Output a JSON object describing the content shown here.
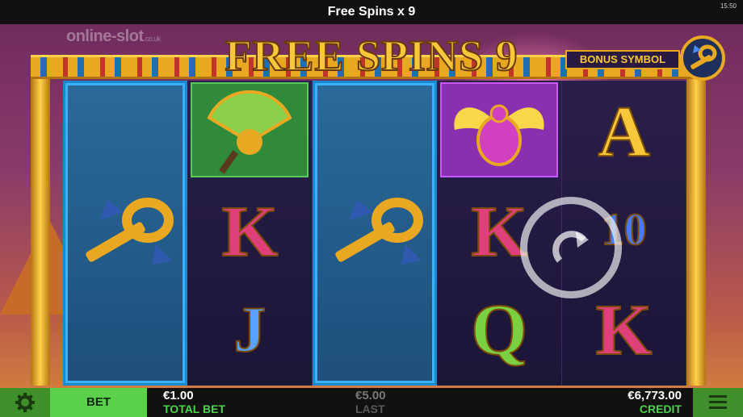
{
  "header": {
    "title": "Free Spins x 9",
    "clock": "15:50"
  },
  "watermark": {
    "text": "online-slot",
    "suffix": ".co.uk"
  },
  "game": {
    "banner": "FREE SPINS 9",
    "bonus_label": "BONUS SYMBOL",
    "bonus_symbol": "ankh-icon",
    "reels": [
      {
        "expanded": true,
        "symbol": "ankh-icon"
      },
      {
        "expanded": false,
        "symbols": [
          "fan-icon",
          "K",
          "J"
        ]
      },
      {
        "expanded": true,
        "symbol": "ankh-icon"
      },
      {
        "expanded": false,
        "symbols": [
          "scarab-icon",
          "K",
          "Q"
        ]
      },
      {
        "expanded": false,
        "symbols": [
          "A",
          "10",
          "K"
        ]
      }
    ],
    "colors": {
      "gold": "#f8c83a",
      "green": "#4cd34a",
      "frame": "#e8a822"
    }
  },
  "footer": {
    "bet_label": "BET",
    "total_bet_value": "€1.00",
    "total_bet_label": "TOTAL BET",
    "last_value": "€5.00",
    "last_label": "LAST",
    "credit_value": "€6,773.00",
    "credit_label": "CREDIT"
  }
}
